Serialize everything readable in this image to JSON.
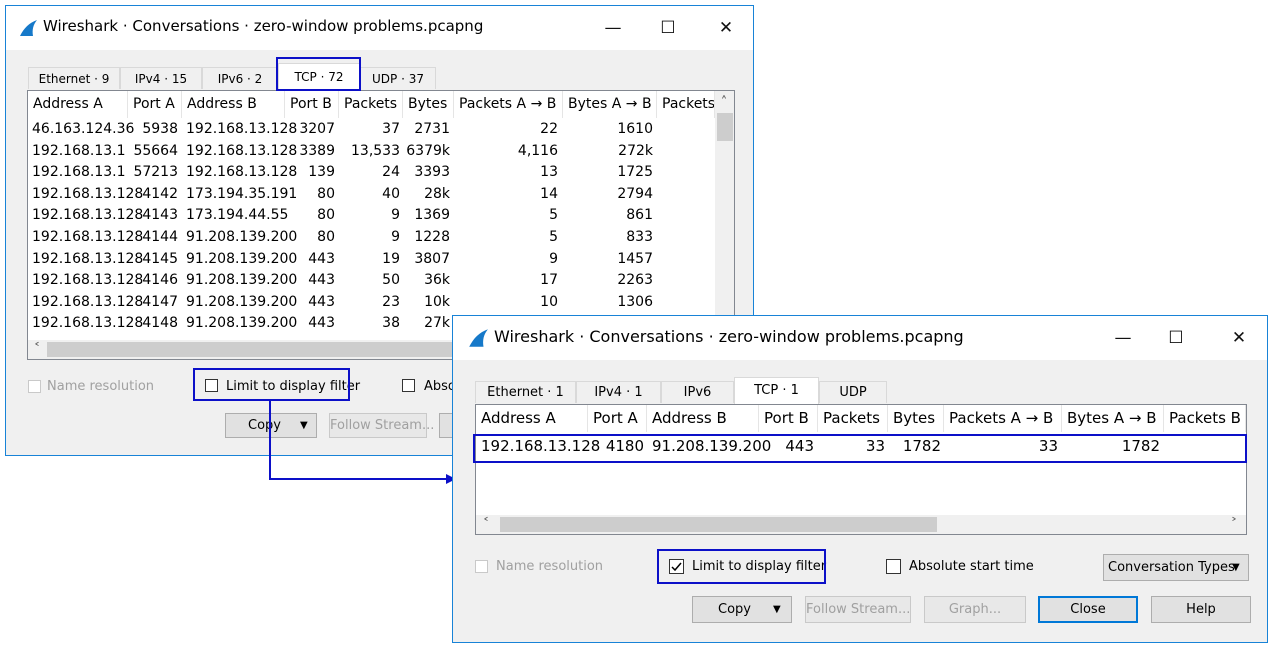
{
  "window1": {
    "title": "Wireshark · Conversations · zero-window problems.pcapng",
    "tabs": [
      "Ethernet · 9",
      "IPv4 · 15",
      "IPv6 · 2",
      "TCP · 72",
      "UDP · 37"
    ],
    "columns": [
      "Address A",
      "Port A",
      "Address B",
      "Port B",
      "Packets",
      "Bytes",
      "Packets A → B",
      "Bytes A → B",
      "Packets"
    ],
    "rows": [
      [
        "46.163.124.36",
        "5938",
        "192.168.13.128",
        "3207",
        "37",
        "2731",
        "22",
        "1610"
      ],
      [
        "192.168.13.1",
        "55664",
        "192.168.13.128",
        "3389",
        "13,533",
        "6379k",
        "4,116",
        "272k"
      ],
      [
        "192.168.13.1",
        "57213",
        "192.168.13.128",
        "139",
        "24",
        "3393",
        "13",
        "1725"
      ],
      [
        "192.168.13.128",
        "4142",
        "173.194.35.191",
        "80",
        "40",
        "28k",
        "14",
        "2794"
      ],
      [
        "192.168.13.128",
        "4143",
        "173.194.44.55",
        "80",
        "9",
        "1369",
        "5",
        "861"
      ],
      [
        "192.168.13.128",
        "4144",
        "91.208.139.200",
        "80",
        "9",
        "1228",
        "5",
        "833"
      ],
      [
        "192.168.13.128",
        "4145",
        "91.208.139.200",
        "443",
        "19",
        "3807",
        "9",
        "1457"
      ],
      [
        "192.168.13.128",
        "4146",
        "91.208.139.200",
        "443",
        "50",
        "36k",
        "17",
        "2263"
      ],
      [
        "192.168.13.128",
        "4147",
        "91.208.139.200",
        "443",
        "23",
        "10k",
        "10",
        "1306"
      ],
      [
        "192.168.13.128",
        "4148",
        "91.208.139.200",
        "443",
        "38",
        "27k",
        "",
        ""
      ]
    ],
    "name_resolution": "Name resolution",
    "limit_filter": "Limit to display filter",
    "absolute_partial": "Abso",
    "copy_label": "Copy",
    "follow_label": "Follow Stream..."
  },
  "window2": {
    "title": "Wireshark · Conversations · zero-window problems.pcapng",
    "tabs": [
      "Ethernet · 1",
      "IPv4 · 1",
      "IPv6",
      "TCP · 1",
      "UDP"
    ],
    "columns": [
      "Address A",
      "Port A",
      "Address B",
      "Port B",
      "Packets",
      "Bytes",
      "Packets A → B",
      "Bytes A → B",
      "Packets B"
    ],
    "rows": [
      [
        "192.168.13.128",
        "4180",
        "91.208.139.200",
        "443",
        "33",
        "1782",
        "33",
        "1782"
      ]
    ],
    "name_resolution": "Name resolution",
    "limit_filter": "Limit to display filter",
    "absolute_start": "Absolute start time",
    "conv_types": "Conversation Types",
    "copy_label": "Copy",
    "follow_label": "Follow Stream...",
    "graph_label": "Graph...",
    "close_label": "Close",
    "help_label": "Help"
  },
  "icons": {
    "app": "wireshark-fin-icon",
    "minimize": "minimize-icon",
    "maximize": "maximize-icon",
    "close": "close-icon"
  },
  "colors": {
    "highlight": "#0c10c8",
    "accent": "#0078d7",
    "fin": "#1679c9"
  }
}
